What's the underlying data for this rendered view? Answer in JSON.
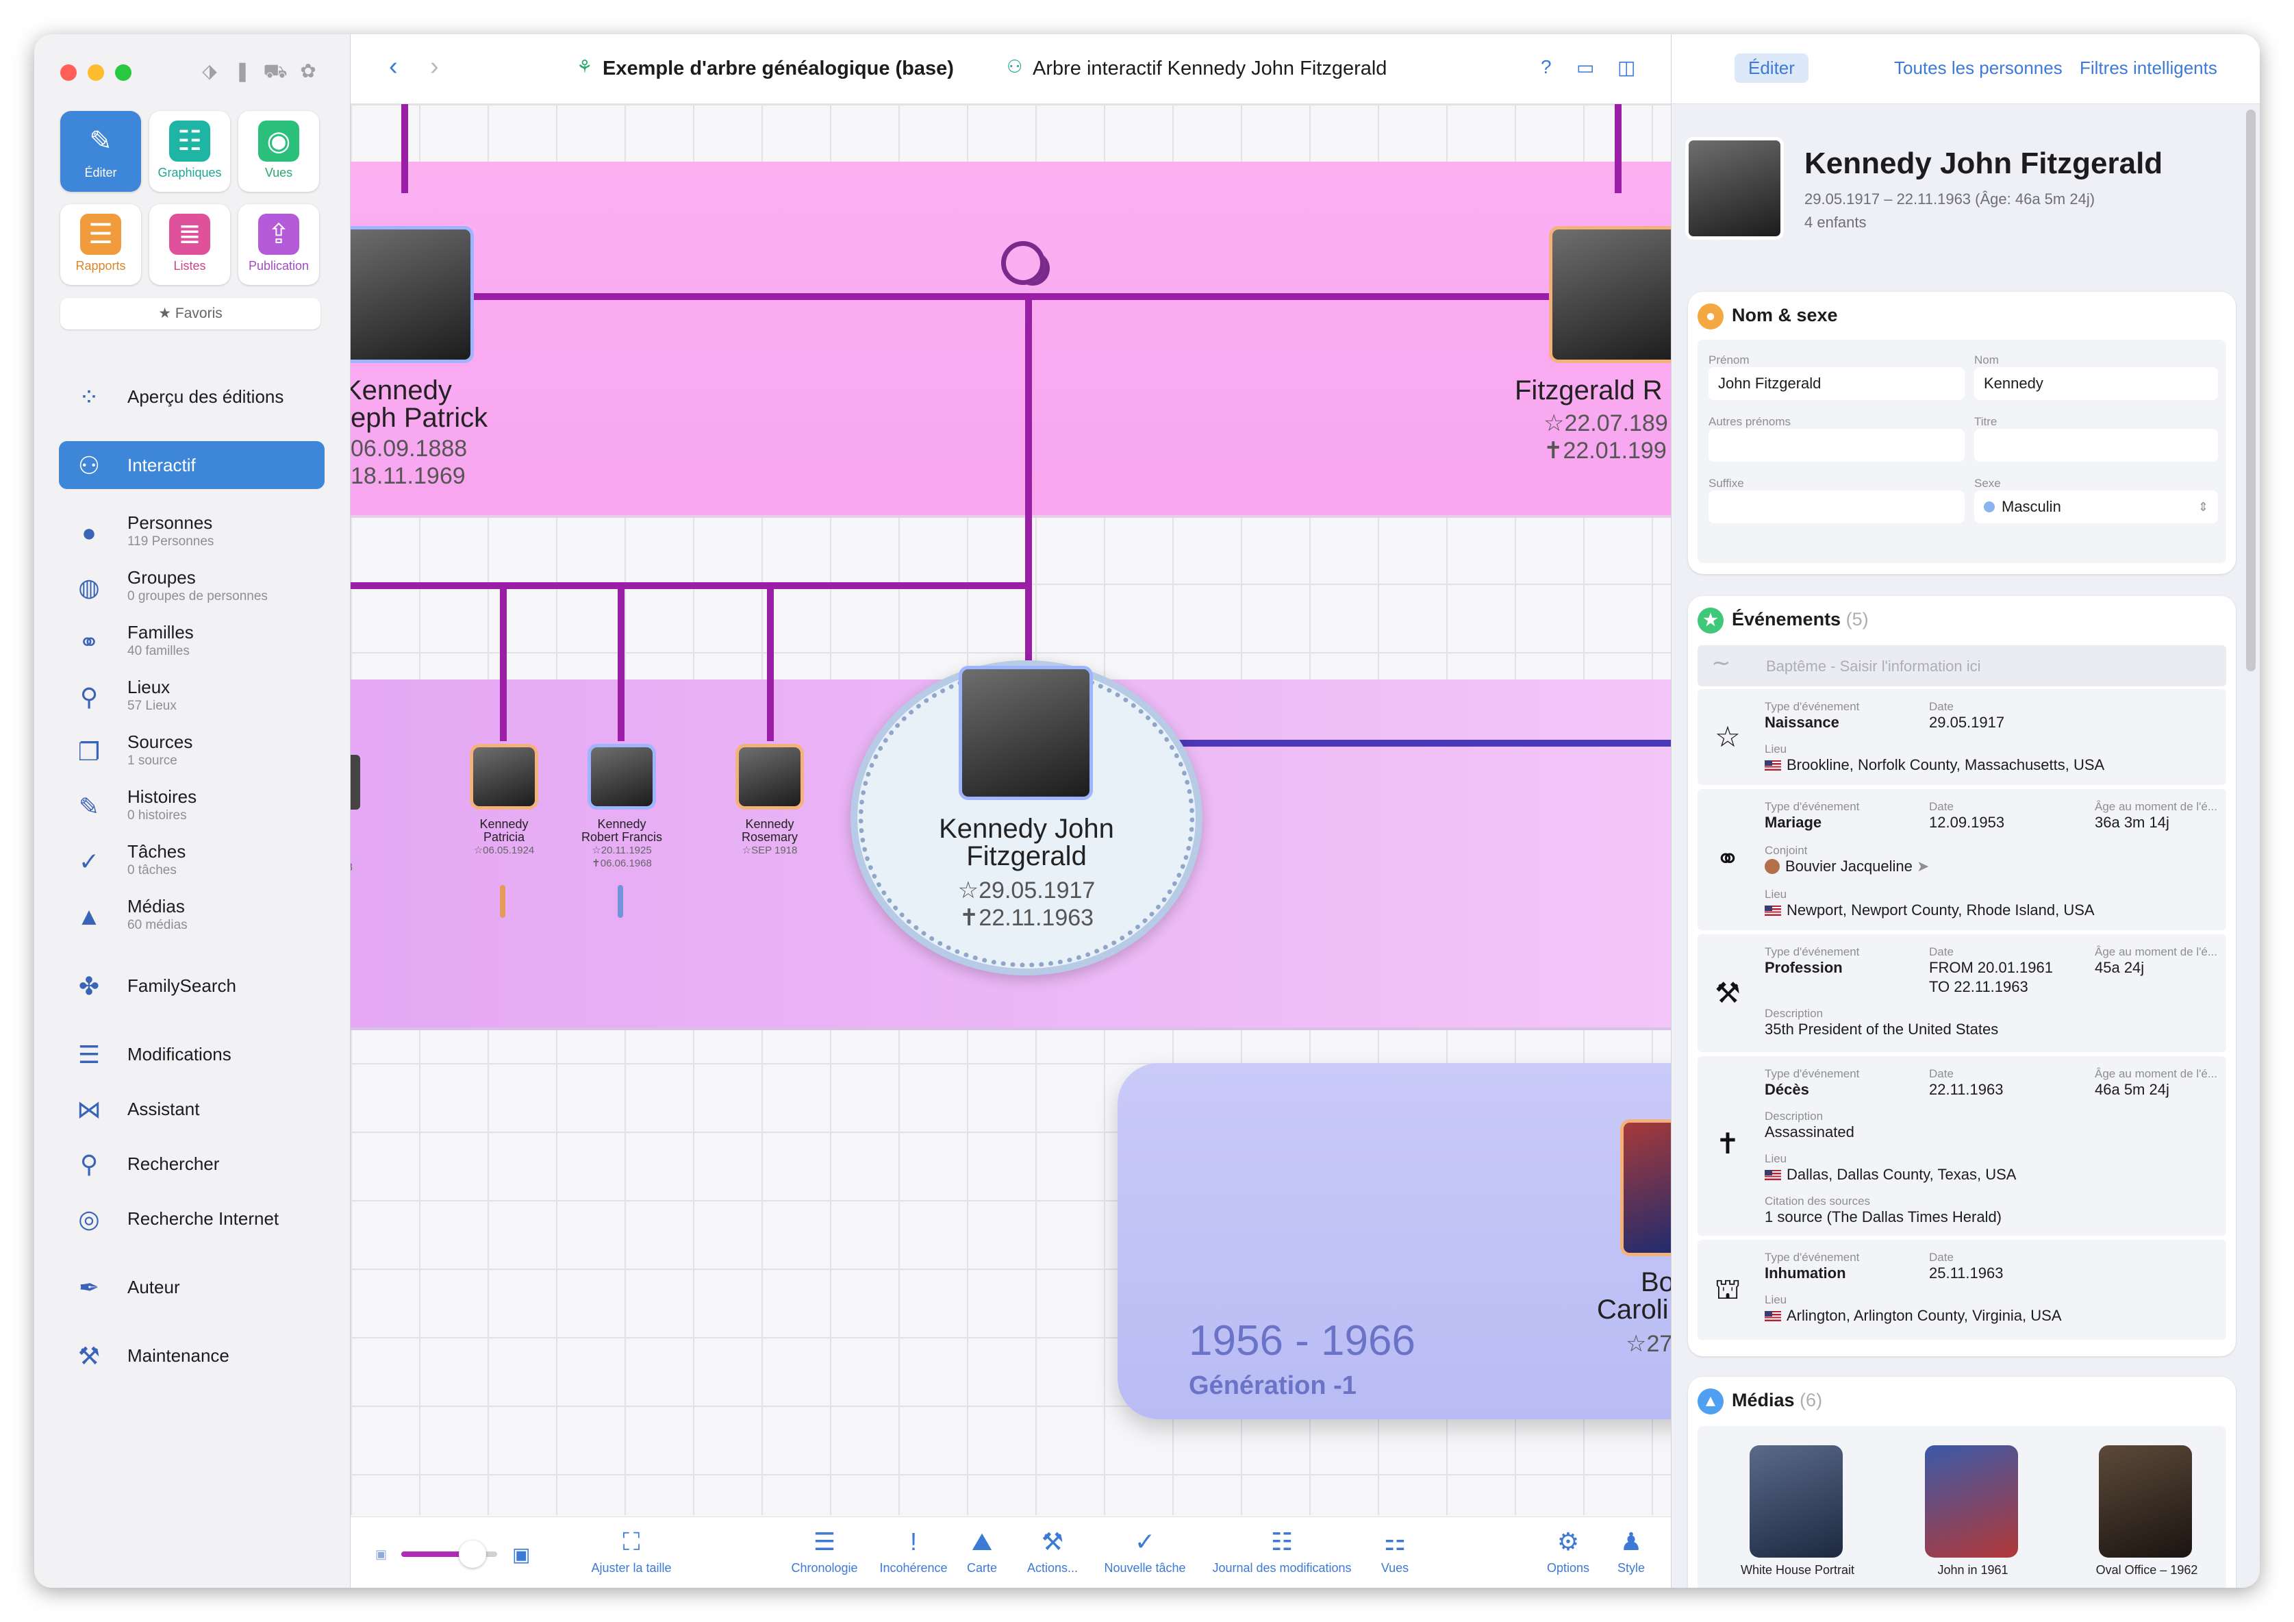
{
  "app": {
    "toolbar_icons": [
      "tag-icon",
      "bookmark-icon",
      "car-icon",
      "brain-icon"
    ],
    "big_buttons": [
      {
        "label": "Éditer",
        "icon": "pencil-icon",
        "color": "#3d86d8"
      },
      {
        "label": "Graphiques",
        "icon": "tree-chart-icon",
        "color": "#1fb5a5"
      },
      {
        "label": "Vues",
        "icon": "eye-icon",
        "color": "#2bbf7c"
      },
      {
        "label": "Rapports",
        "icon": "report-icon",
        "color": "#f09b3c"
      },
      {
        "label": "Listes",
        "icon": "list-icon",
        "color": "#e0519c"
      },
      {
        "label": "Publication",
        "icon": "upload-icon",
        "color": "#b55ad8"
      }
    ],
    "favorites": "★ Favoris"
  },
  "sidebar": {
    "items": [
      {
        "label": "Aperçu des éditions",
        "sub": "",
        "icon": "grid-icon"
      },
      {
        "label": "Interactif",
        "sub": "",
        "icon": "tree-icon"
      },
      {
        "label": "Personnes",
        "sub": "119 Personnes",
        "icon": "person-icon"
      },
      {
        "label": "Groupes",
        "sub": "0 groupes de personnes",
        "icon": "group-icon"
      },
      {
        "label": "Familles",
        "sub": "40 familles",
        "icon": "rings-icon"
      },
      {
        "label": "Lieux",
        "sub": "57 Lieux",
        "icon": "pin-icon"
      },
      {
        "label": "Sources",
        "sub": "1 source",
        "icon": "sources-icon"
      },
      {
        "label": "Histoires",
        "sub": "0 histoires",
        "icon": "story-icon"
      },
      {
        "label": "Tâches",
        "sub": "0  tâches",
        "icon": "check-icon"
      },
      {
        "label": "Médias",
        "sub": "60 médias",
        "icon": "media-icon"
      },
      {
        "label": "FamilySearch",
        "sub": "",
        "icon": "familysearch-icon"
      },
      {
        "label": "Modifications",
        "sub": "",
        "icon": "changes-icon"
      },
      {
        "label": "Assistant",
        "sub": "",
        "icon": "assistant-icon"
      },
      {
        "label": "Rechercher",
        "sub": "",
        "icon": "search-icon"
      },
      {
        "label": "Recherche Internet",
        "sub": "",
        "icon": "globe-search-icon"
      },
      {
        "label": "Auteur",
        "sub": "",
        "icon": "pen-icon"
      },
      {
        "label": "Maintenance",
        "sub": "",
        "icon": "maintenance-icon"
      }
    ]
  },
  "header": {
    "db_title": "Exemple d'arbre généalogique (base)",
    "view_title": "Arbre interactif Kennedy John Fitzgerald",
    "help": "?"
  },
  "tree": {
    "father": {
      "name1": "Kennedy",
      "name2": "eph Patrick",
      "birth": "06.09.1888",
      "death": "18.11.1969"
    },
    "mother": {
      "name": "Fitzgerald R",
      "birth": "☆22.07.189",
      "death": "✝22.01.199"
    },
    "children": [
      {
        "name1": "Kennedy",
        "name2": "Patricia",
        "d1": "☆06.05.1924",
        "d2": ""
      },
      {
        "name1": "Kennedy",
        "name2": "Robert Francis",
        "d1": "☆20.11.1925",
        "d2": "✝06.06.1968"
      },
      {
        "name1": "Kennedy",
        "name2": "Rosemary",
        "d1": "☆SEP 1918",
        "d2": ""
      }
    ],
    "edge_fragment": "8",
    "focus": {
      "name1": "Kennedy John",
      "name2": "Fitzgerald",
      "birth": "☆29.05.1917",
      "death": "✝22.11.1963"
    },
    "generation": {
      "years": "1956 - 1966",
      "label": "Génération -1"
    },
    "spouse_fragment": {
      "name1": "Bo",
      "name2": "Caroli",
      "date": "☆27"
    }
  },
  "bottombar": [
    {
      "label": "Ajuster la taille",
      "icon": "fit-icon"
    },
    {
      "label": "Chronologie",
      "icon": "timeline-icon"
    },
    {
      "label": "Incohérence",
      "icon": "warning-icon"
    },
    {
      "label": "Carte",
      "icon": "map-icon"
    },
    {
      "label": "Actions...",
      "icon": "hammer-icon"
    },
    {
      "label": "Nouvelle tâche",
      "icon": "new-task-icon"
    },
    {
      "label": "Journal des modifications",
      "icon": "log-icon"
    },
    {
      "label": "Vues",
      "icon": "views-icon"
    },
    {
      "label": "Options",
      "icon": "options-icon"
    },
    {
      "label": "Style",
      "icon": "style-icon"
    }
  ],
  "inspector": {
    "tabs": [
      "Éditer",
      "Toutes les personnes",
      "Filtres intelligents"
    ],
    "person": {
      "name": "Kennedy John Fitzgerald",
      "dates": "29.05.1917 – 22.11.1963 (Âge: 46a 5m 24j)",
      "children": "4 enfants"
    },
    "name_sex": {
      "title": "Nom & sexe",
      "prenom_label": "Prénom",
      "prenom": "John Fitzgerald",
      "nom_label": "Nom",
      "nom": "Kennedy",
      "autres_label": "Autres prénoms",
      "autres": "",
      "titre_label": "Titre",
      "titre": "",
      "suffixe_label": "Suffixe",
      "suffixe": "",
      "sexe_label": "Sexe",
      "sexe": "Masculin"
    },
    "events": {
      "title": "Événements",
      "count": "(5)",
      "placeholder": "Baptême - Saisir l'information ici",
      "type_label": "Type d'événement",
      "date_label": "Date",
      "age_label": "Âge au moment de l'é...",
      "place_label": "Lieu",
      "desc_label": "Description",
      "spouse_label": "Conjoint",
      "sources_label": "Citation des sources",
      "items": [
        {
          "type": "Naissance",
          "date": "29.05.1917",
          "place": "Brookline, Norfolk County, Massachusetts, USA",
          "icon": "star-icon"
        },
        {
          "type": "Mariage",
          "date": "12.09.1953",
          "age": "36a 3m 14j",
          "spouse": "Bouvier Jacqueline",
          "place": "Newport, Newport County, Rhode Island, USA",
          "icon": "rings-icon"
        },
        {
          "type": "Profession",
          "date": "FROM 20.01.1961",
          "date2": "TO 22.11.1963",
          "age": "45a 24j",
          "desc": "35th President of the United States",
          "icon": "hammer-icon"
        },
        {
          "type": "Décès",
          "date": "22.11.1963",
          "age": "46a 5m 24j",
          "desc": "Assassinated",
          "place": "Dallas, Dallas County, Texas, USA",
          "sources": "1 source (The Dallas Times Herald)",
          "icon": "cross-icon"
        },
        {
          "type": "Inhumation",
          "date": "25.11.1963",
          "place": "Arlington, Arlington County, Virginia, USA",
          "icon": "grave-icon"
        }
      ]
    },
    "media": {
      "title": "Médias",
      "count": "(6)",
      "items": [
        "White House Portrait",
        "John in 1961",
        "Oval Office – 1962"
      ]
    }
  },
  "colors": {
    "accent": "#3d86d8",
    "band_parents": "#fcb0f2",
    "band_children": "#e4a8f4",
    "line": "#9a1fa6",
    "generation": "#c9caf8"
  }
}
